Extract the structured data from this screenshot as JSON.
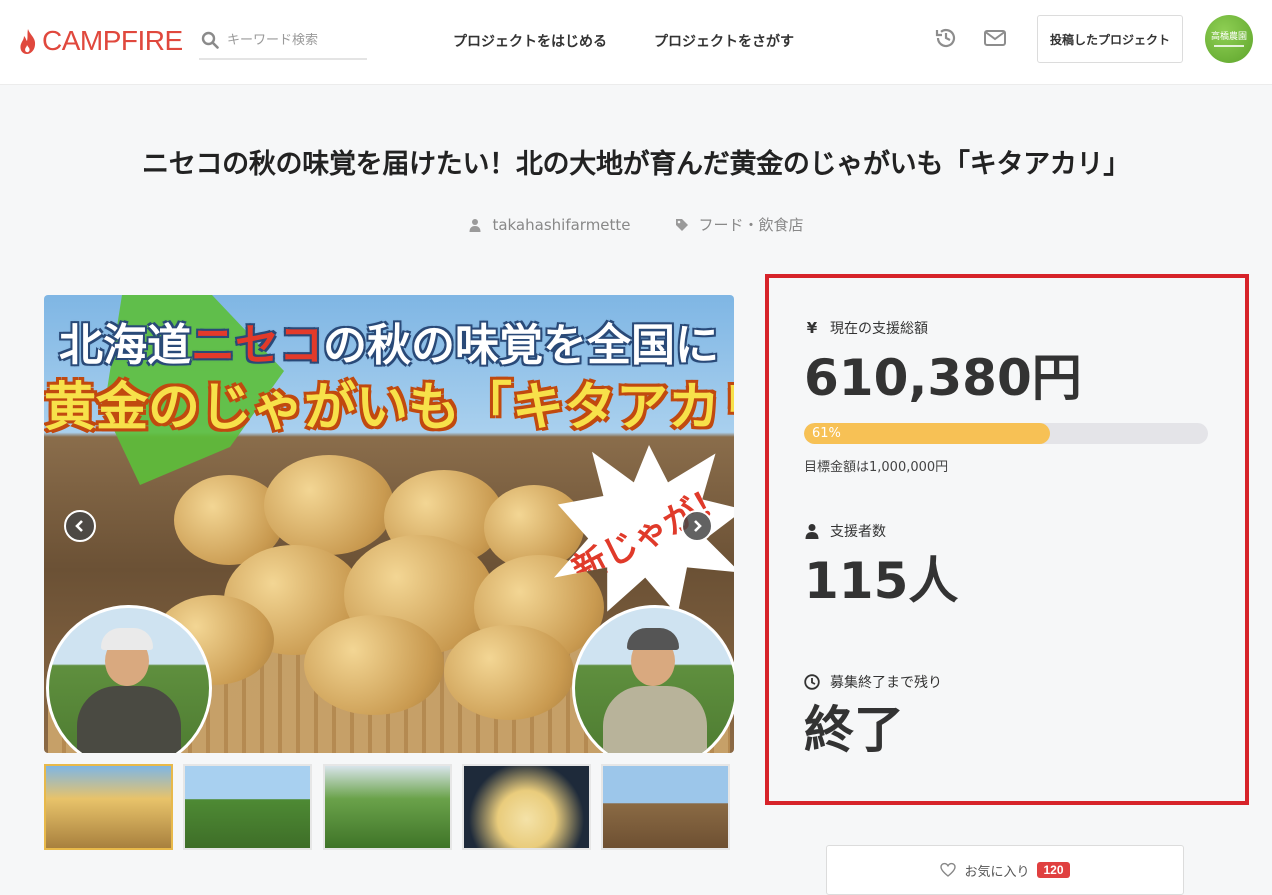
{
  "header": {
    "logo_text": "CAMPFIRE",
    "search_placeholder": "キーワード検索",
    "nav": [
      "プロジェクトをはじめる",
      "プロジェクトをさがす"
    ],
    "posted_projects_label": "投稿したプロジェクト",
    "avatar_text": "高橋農園",
    "brand_color": "#e0483d"
  },
  "project": {
    "title": "ニセコの秋の味覚を届けたい！北の大地が育んだ黄金のじゃがいも「キタアカリ」",
    "owner": "takahashifarmette",
    "category": "フード・飲食店"
  },
  "hero": {
    "headline_pre": "北海道",
    "headline_red": "ニセコ",
    "headline_post": "の秋の味覚を全国に",
    "headline2": "黄金のじゃがいも「キタアカリ」",
    "burst_text": "新じゃが！"
  },
  "stats": {
    "raised_label": "現在の支援総額",
    "raised_value": "610,380円",
    "progress_text": "61%",
    "progress_fraction": 0.61,
    "goal_text": "目標金額は1,000,000円",
    "backers_label": "支援者数",
    "backers_value": "115人",
    "remaining_label": "募集終了まで残り",
    "remaining_value": "終了",
    "highlight_color": "#d7232a",
    "progress_color": "#f7c155"
  },
  "favorite": {
    "label": "お気に入り",
    "count": "120"
  }
}
